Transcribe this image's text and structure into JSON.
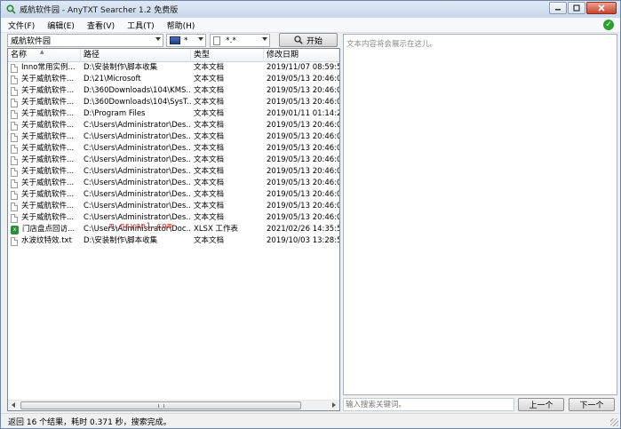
{
  "window": {
    "title": "威航软件园 - AnyTXT Searcher 1.2 免费版"
  },
  "menu": [
    "文件(F)",
    "编辑(E)",
    "查看(V)",
    "工具(T)",
    "帮助(H)"
  ],
  "toolbar": {
    "location_value": "威航软件园",
    "disk_value": "*",
    "ext_value": "*.*",
    "start_label": "开始"
  },
  "table": {
    "columns": [
      "名称",
      "路径",
      "类型",
      "修改日期"
    ],
    "rows": [
      {
        "icon": "document-icon",
        "name": "Inno常用实例...",
        "path": "D:\\安装制作\\脚本收集",
        "type": "文本文档",
        "date": "2019/11/07 08:59:50"
      },
      {
        "icon": "document-icon",
        "name": "关于威航软件...",
        "path": "D:\\21\\Microsoft",
        "type": "文本文档",
        "date": "2019/05/13 20:46:07"
      },
      {
        "icon": "document-icon",
        "name": "关于威航软件...",
        "path": "D:\\360Downloads\\104\\KMS...",
        "type": "文本文档",
        "date": "2019/05/13 20:46:06"
      },
      {
        "icon": "document-icon",
        "name": "关于威航软件...",
        "path": "D:\\360Downloads\\104\\SysT...",
        "type": "文本文档",
        "date": "2019/05/13 20:46:06"
      },
      {
        "icon": "document-icon",
        "name": "关于威航软件...",
        "path": "D:\\Program Files",
        "type": "文本文档",
        "date": "2019/01/11 01:14:21"
      },
      {
        "icon": "document-icon",
        "name": "关于威航软件...",
        "path": "C:\\Users\\Administrator\\Des...",
        "type": "文本文档",
        "date": "2019/05/13 20:46:06"
      },
      {
        "icon": "document-icon",
        "name": "关于威航软件...",
        "path": "C:\\Users\\Administrator\\Des...",
        "type": "文本文档",
        "date": "2019/05/13 20:46:06"
      },
      {
        "icon": "document-icon",
        "name": "关于威航软件...",
        "path": "C:\\Users\\Administrator\\Des...",
        "type": "文本文档",
        "date": "2019/05/13 20:46:06"
      },
      {
        "icon": "document-icon",
        "name": "关于威航软件...",
        "path": "C:\\Users\\Administrator\\Des...",
        "type": "文本文档",
        "date": "2019/05/13 20:46:06"
      },
      {
        "icon": "document-icon",
        "name": "关于威航软件...",
        "path": "C:\\Users\\Administrator\\Des...",
        "type": "文本文档",
        "date": "2019/05/13 20:46:06"
      },
      {
        "icon": "document-icon",
        "name": "关于威航软件...",
        "path": "C:\\Users\\Administrator\\Des...",
        "type": "文本文档",
        "date": "2019/05/13 20:46:06"
      },
      {
        "icon": "document-icon",
        "name": "关于威航软件...",
        "path": "C:\\Users\\Administrator\\Des...",
        "type": "文本文档",
        "date": "2019/05/13 20:46:07"
      },
      {
        "icon": "document-icon",
        "name": "关于威航软件...",
        "path": "C:\\Users\\Administrator\\Des...",
        "type": "文本文档",
        "date": "2019/05/13 20:46:06"
      },
      {
        "icon": "document-icon",
        "name": "关于威航软件...",
        "path": "C:\\Users\\Administrator\\Des...",
        "type": "文本文档",
        "date": "2019/05/13 20:46:06"
      },
      {
        "icon": "excel-icon",
        "name": "门店盘点回访...",
        "path": "C:\\Users\\Administrator\\Doc...",
        "type": "XLSX 工作表",
        "date": "2021/02/26 14:35:59"
      },
      {
        "icon": "document-icon",
        "name": "水波纹特效.txt",
        "path": "D:\\安装制作\\脚本收集",
        "type": "文本文档",
        "date": "2019/10/03 13:28:54"
      }
    ]
  },
  "watermark": "m.nsyan1.com",
  "preview": {
    "placeholder": "文本内容将会展示在这儿。"
  },
  "keyword": {
    "placeholder": "输入搜索关键词。",
    "prev_label": "上一个",
    "next_label": "下一个"
  },
  "status": "返回 16 个结果，耗时 0.371 秒，搜索完成。"
}
